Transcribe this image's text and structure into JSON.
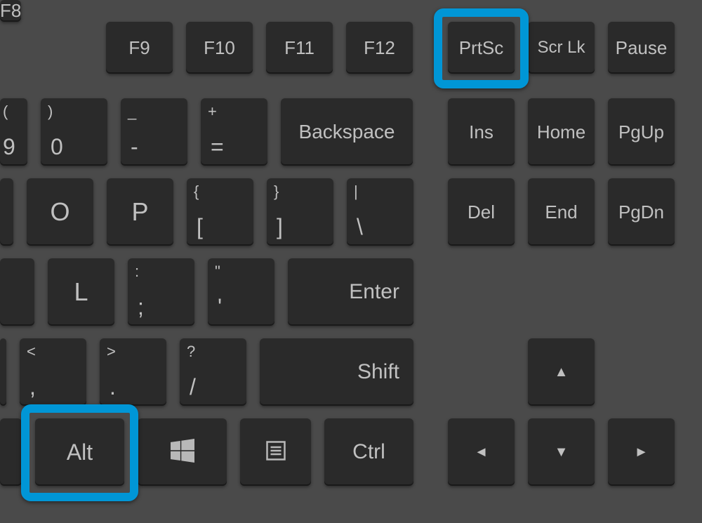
{
  "highlight_color": "#0096d6",
  "row1": {
    "f8": "F8",
    "f9": "F9",
    "f10": "F10",
    "f11": "F11",
    "f12": "F12",
    "prtsc": "PrtSc",
    "scrlk": "Scr Lk",
    "pause": "Pause"
  },
  "row2": {
    "nine": {
      "upper": "(",
      "lower": "9"
    },
    "zero": {
      "upper": ")",
      "lower": "0"
    },
    "minus": {
      "upper": "_",
      "lower": "-"
    },
    "equals": {
      "upper": "+",
      "lower": "="
    },
    "backspace": "Backspace",
    "ins": "Ins",
    "home": "Home",
    "pgup": "PgUp"
  },
  "row3": {
    "o": "O",
    "p": "P",
    "lbracket": {
      "upper": "{",
      "lower": "["
    },
    "rbracket": {
      "upper": "}",
      "lower": "]"
    },
    "backslash": {
      "upper": "|",
      "lower": "\\"
    },
    "del": "Del",
    "end": "End",
    "pgdn": "PgDn"
  },
  "row4": {
    "l": "L",
    "semicolon": {
      "upper": ":",
      "lower": ";"
    },
    "quote": {
      "upper": "\"",
      "lower": "'"
    },
    "enter": "Enter"
  },
  "row5": {
    "comma": {
      "upper": "<",
      "lower": ","
    },
    "period": {
      "upper": ">",
      "lower": "."
    },
    "slash": {
      "upper": "?",
      "lower": "/"
    },
    "shift": "Shift",
    "up": "▲"
  },
  "row6": {
    "alt": "Alt",
    "win": "windows-icon",
    "menu": "menu-icon",
    "ctrl": "Ctrl",
    "left": "◄",
    "down": "▼",
    "right": "►"
  }
}
